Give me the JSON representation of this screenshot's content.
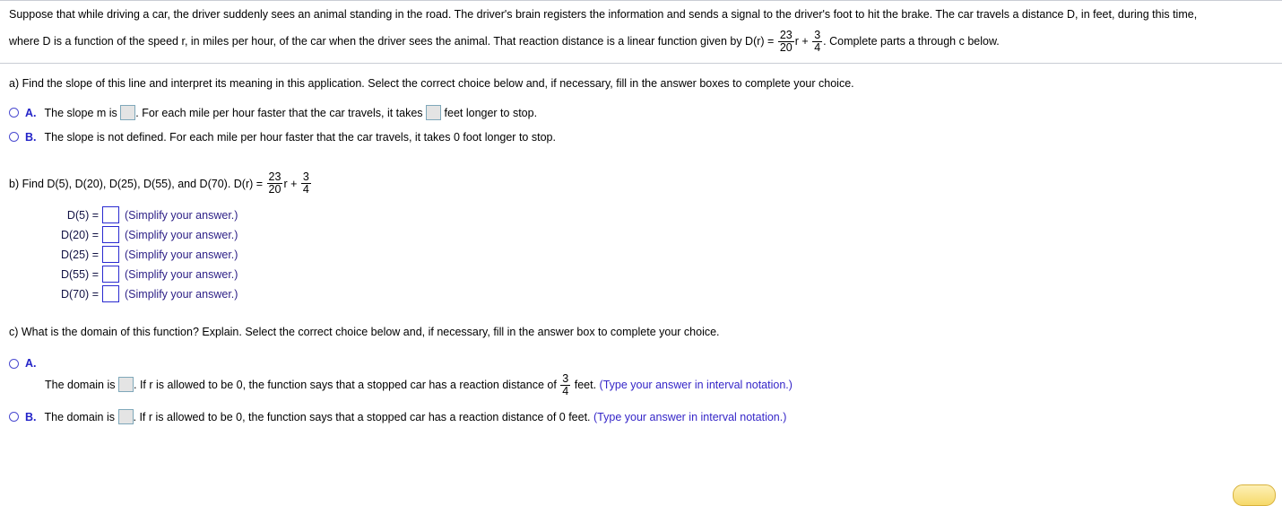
{
  "problem": {
    "line1": "Suppose that while driving a car, the driver suddenly sees an animal standing in the road. The driver's brain registers the information and sends a signal to the driver's foot to hit the brake. The car travels a distance D, in feet, during this time,",
    "line2_before": "where D is a function of the speed r, in miles per hour, of the car when the driver sees the animal. That reaction distance is a linear function given by D(r) =",
    "line2_after": ". Complete parts a through c below.",
    "formula": {
      "frac1_num": "23",
      "frac1_den": "20",
      "variable": "r",
      "plus": "+",
      "frac2_num": "3",
      "frac2_den": "4"
    }
  },
  "part_a": {
    "prompt": "a) Find the slope of this line and interpret its meaning in this application. Select the correct choice below and, if necessary, fill in the answer boxes to complete your choice.",
    "choices": [
      {
        "label": "A.",
        "text_part1": "The slope m is",
        "text_part2": ". For each mile per hour faster that the car travels, it takes",
        "text_part3": "feet longer to stop."
      },
      {
        "label": "B.",
        "text": "The slope is not defined. For each mile per hour faster that the car travels, it takes 0 foot longer to stop."
      }
    ]
  },
  "part_b": {
    "prompt_before": "b) Find D(5), D(20), D(25), D(55), and D(70). D(r) =",
    "formula": {
      "frac1_num": "23",
      "frac1_den": "20",
      "variable": "r",
      "plus": "+",
      "frac2_num": "3",
      "frac2_den": "4"
    },
    "hint": "(Simplify your answer.)",
    "rows": [
      {
        "label": "D(5) =",
        "value": ""
      },
      {
        "label": "D(20) =",
        "value": ""
      },
      {
        "label": "D(25) =",
        "value": ""
      },
      {
        "label": "D(55) =",
        "value": ""
      },
      {
        "label": "D(70) =",
        "value": ""
      }
    ]
  },
  "part_c": {
    "prompt": "c) What is the domain of this function? Explain. Select the correct choice below and, if necessary, fill in the answer box to complete your choice.",
    "choices": [
      {
        "label": "A.",
        "text_part1": "The domain is",
        "text_part2": ". If r is allowed to be 0, the function says that a stopped car has a reaction distance of",
        "frac_num": "3",
        "frac_den": "4",
        "text_part3": "feet.",
        "note": "(Type your answer in interval notation.)"
      },
      {
        "label": "B.",
        "text_part1": "The domain is",
        "text_part2": ". If r is allowed to be 0, the function says that a stopped car has a reaction distance of 0 feet.",
        "note": "(Type your answer in interval notation.)"
      }
    ]
  },
  "footer": {
    "button_icon": "rounded-button-partial"
  },
  "colors": {
    "choice_label": "#2323c8",
    "radio_border": "#4a4ad0",
    "hint_text": "#2c1f86",
    "note_text": "#3526c8",
    "box_gray_fill": "#e4e4e4",
    "box_gray_border": "#7fa8ba",
    "box_white_border": "#2a2ad0",
    "rule": "#c9cdd4",
    "button": "#f6d96a"
  }
}
